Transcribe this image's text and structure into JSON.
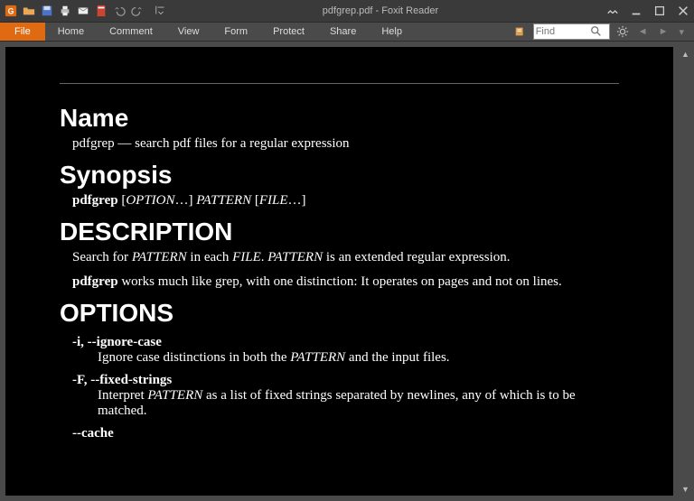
{
  "title": "pdfgrep.pdf - Foxit Reader",
  "menu": {
    "file": "File",
    "home": "Home",
    "comment": "Comment",
    "view": "View",
    "form": "Form",
    "protect": "Protect",
    "share": "Share",
    "help": "Help"
  },
  "search": {
    "placeholder": "Find"
  },
  "doc": {
    "h_name": "Name",
    "name_line_a": "pdfgrep — search pdf files for a regular expression",
    "h_synopsis": "Synopsis",
    "syn_cmd": "pdfgrep",
    "syn_a": " [",
    "syn_opt": "OPTION",
    "syn_b": "…] ",
    "syn_pat": "PATTERN",
    "syn_c": " [",
    "syn_file": "FILE",
    "syn_d": "…]",
    "h_desc": "DESCRIPTION",
    "desc1_a": "Search for ",
    "desc1_pat": "PATTERN",
    "desc1_b": " in each ",
    "desc1_file": "FILE",
    "desc1_c": ". ",
    "desc1_pat2": "PATTERN",
    "desc1_d": " is an extended regular expression.",
    "desc2_cmd": "pdfgrep",
    "desc2_rest": " works much like grep, with one distinction: It operates on pages and not on lines.",
    "h_options": "OPTIONS",
    "opt1_flag": "-i, --ignore-case",
    "opt1_a": "Ignore case distinctions in both the ",
    "opt1_pat": "PATTERN",
    "opt1_b": " and the input files.",
    "opt2_flag": "-F, --fixed-strings",
    "opt2_a": "Interpret ",
    "opt2_pat": "PATTERN",
    "opt2_b": " as a list of fixed strings separated by newlines, any of which is to be matched.",
    "opt3_flag": "--cache"
  }
}
